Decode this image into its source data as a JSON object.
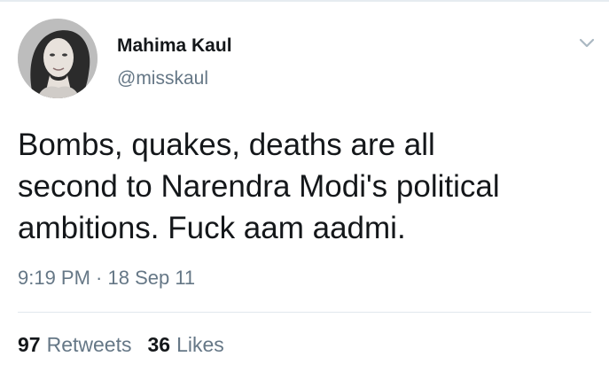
{
  "author": {
    "display_name": "Mahima Kaul",
    "handle": "@misskaul",
    "avatar_icon": "profile-photo"
  },
  "tweet": {
    "text": "Bombs, quakes, deaths are all\nsecond to Narendra Modi's political\nambitions. Fuck aam aadmi.",
    "timestamp": "9:19 PM · 18 Sep 11"
  },
  "stats": {
    "retweets_count": "97",
    "retweets_label": "Retweets",
    "likes_count": "36",
    "likes_label": "Likes"
  },
  "menu": {
    "icon": "chevron-down-icon"
  },
  "colors": {
    "primary_text": "#14171a",
    "secondary_text": "#657786",
    "divider": "#e1e8ed"
  }
}
